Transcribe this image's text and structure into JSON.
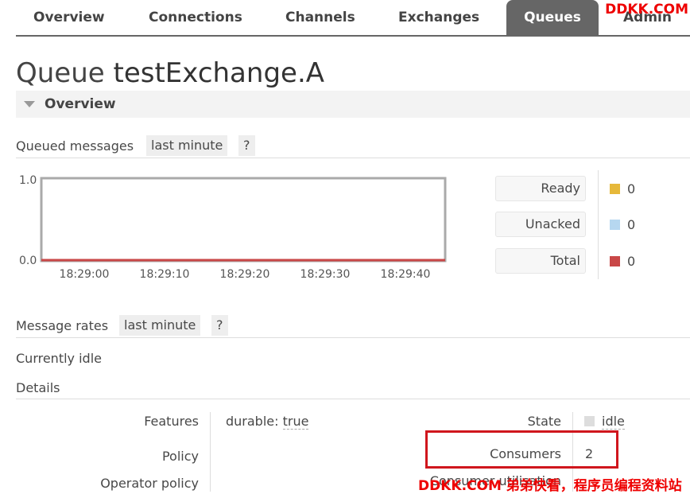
{
  "nav": {
    "tabs": [
      "Overview",
      "Connections",
      "Channels",
      "Exchanges",
      "Queues",
      "Admin"
    ],
    "active": "Queues"
  },
  "watermark_top": "DDKK.COM",
  "title": {
    "prefix": "Queue",
    "name": "testExchange.A"
  },
  "overview_section": "Overview",
  "queued": {
    "label": "Queued messages",
    "range": "last minute",
    "help": "?"
  },
  "chart_data": {
    "type": "line",
    "x": [
      "18:29:00",
      "18:29:10",
      "18:29:20",
      "18:29:30",
      "18:29:40"
    ],
    "ylim": [
      0.0,
      1.0
    ],
    "yticks": [
      "1.0",
      "0.0"
    ],
    "series": [
      {
        "name": "Ready",
        "values": [
          0,
          0,
          0,
          0,
          0
        ],
        "color": "#e6b83a"
      },
      {
        "name": "Unacked",
        "values": [
          0,
          0,
          0,
          0,
          0
        ],
        "color": "#b6d7f0"
      },
      {
        "name": "Total",
        "values": [
          0,
          0,
          0,
          0,
          0
        ],
        "color": "#c94747"
      }
    ]
  },
  "legend": [
    {
      "label": "Ready",
      "value": "0",
      "color": "#e6b83a"
    },
    {
      "label": "Unacked",
      "value": "0",
      "color": "#b6d7f0"
    },
    {
      "label": "Total",
      "value": "0",
      "color": "#c94747"
    }
  ],
  "rates": {
    "label": "Message rates",
    "range": "last minute",
    "help": "?"
  },
  "idle_text": "Currently idle",
  "details_label": "Details",
  "details": {
    "features_label": "Features",
    "features_key": "durable:",
    "features_value": "true",
    "policy_label": "Policy",
    "operator_policy_label": "Operator policy",
    "state_label": "State",
    "state_value": "idle",
    "consumers_label": "Consumers",
    "consumers_value": "2",
    "consumer_util_label": "Consumer utilisation"
  },
  "watermark_bottom": "DDKK.COM 弟弟快看，程序员编程资料站"
}
